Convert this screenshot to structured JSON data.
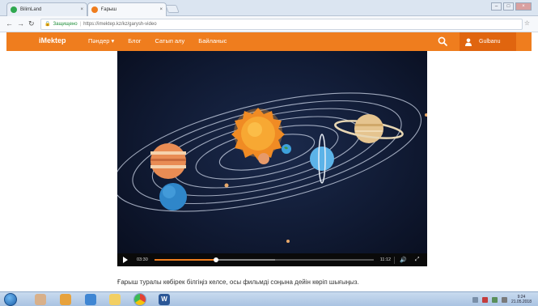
{
  "browser": {
    "tabs": [
      {
        "title": "BilimLand",
        "favicon_color": "#2fa84f",
        "active": false
      },
      {
        "title": "Ғарыш",
        "favicon_color": "#ef7d1e",
        "active": true
      }
    ],
    "close_glyph": "×",
    "address": {
      "secure_label": "Защищено",
      "url": "https://imektep.kz/kz/garysh-video"
    },
    "window_controls": [
      "–",
      "□",
      "×"
    ]
  },
  "site": {
    "logo": "iMektep",
    "nav": [
      {
        "label": "Пәндер ▾"
      },
      {
        "label": "Блог"
      },
      {
        "label": "Сатып алу"
      },
      {
        "label": "Байланыс"
      }
    ],
    "user_name": "Gulbanu",
    "accent_color": "#ef7d1e"
  },
  "video": {
    "current_time": "03:30",
    "total_time": "11:12",
    "progress": 0.28,
    "buffered": 0.55
  },
  "caption": "Ғарыш туралы көбірек білгіңіз келсе, осы фильмді соңына дейін көріп шығыңыз.",
  "taskbar": {
    "clock_time": "9:24",
    "clock_date": "21.05.2018"
  }
}
